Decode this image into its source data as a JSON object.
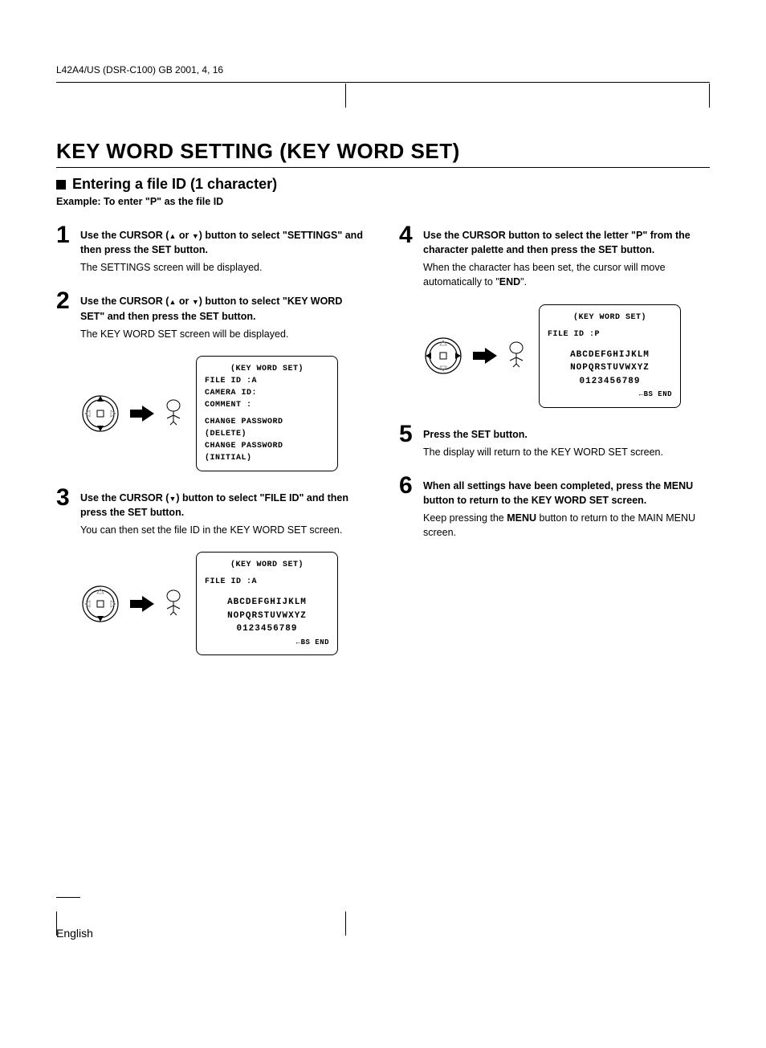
{
  "header": "L42A4/US (DSR-C100)   GB   2001, 4, 16",
  "title": "KEY WORD SETTING (KEY WORD SET)",
  "section": "Entering a file ID (1 character)",
  "example": "Example: To enter \"P\" as the file ID",
  "steps": {
    "1": {
      "bold_pre": "Use the CURSOR (",
      "bold_mid": " or ",
      "bold_post": ") button to select \"SETTINGS\" and then press the SET button.",
      "text": "The SETTINGS screen will be displayed."
    },
    "2": {
      "bold_pre": "Use the CURSOR (",
      "bold_mid": " or ",
      "bold_post": ") button to select \"KEY WORD SET\" and then press the SET button.",
      "text": "The KEY WORD SET screen will be displayed."
    },
    "3": {
      "bold_pre": "Use the CURSOR (",
      "bold_post": ") button to select \"FILE ID\" and then press the SET button.",
      "text": "You can then set the file ID in the KEY WORD SET screen."
    },
    "4": {
      "bold": "Use the CURSOR button to select the letter \"P\" from the character palette and then press the SET button.",
      "text_pre": "When the character has been set, the cursor will move automatically to \"",
      "text_bold": "END",
      "text_post": "\"."
    },
    "5": {
      "bold": "Press the SET button.",
      "text": "The display will return to the KEY WORD SET screen."
    },
    "6": {
      "bold": "When all settings have been completed, press the MENU button to return to the KEY WORD SET screen.",
      "text_pre": "Keep pressing the ",
      "text_bold": "MENU",
      "text_post": " button to return to the MAIN MENU screen."
    }
  },
  "screens": {
    "s2": {
      "title": "(KEY WORD SET)",
      "l1": "FILE ID  :A",
      "l2": "CAMERA ID:",
      "l3": "COMMENT  :",
      "l4": "CHANGE PASSWORD (DELETE)",
      "l5": "CHANGE PASSWORD (INITIAL)"
    },
    "s3": {
      "title": "(KEY WORD SET)",
      "l1": "FILE ID  :A",
      "p1": "ABCDEFGHIJKLM",
      "p2": "NOPQRSTUVWXYZ",
      "p3": "0123456789",
      "bs": "BS END"
    },
    "s4": {
      "title": "(KEY WORD SET)",
      "l1": "FILE ID  :P",
      "p1": "ABCDEFGHIJKLM",
      "p2": "NOPQRSTUVWXYZ",
      "p3": "0123456789",
      "bs": "BS END"
    }
  },
  "footer": "English"
}
